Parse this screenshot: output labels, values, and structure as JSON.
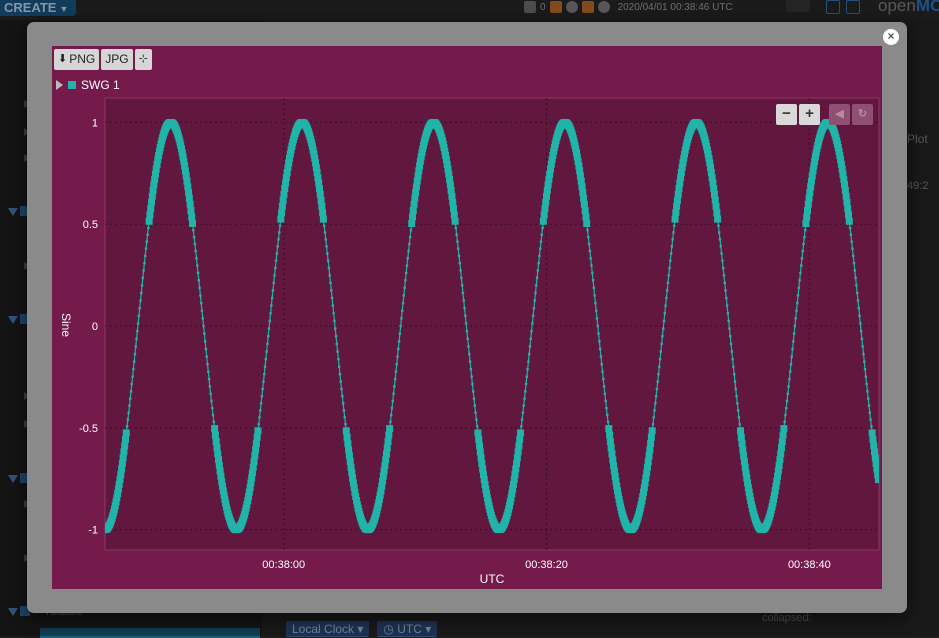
{
  "app": {
    "create_label": "CREATE",
    "status_time": "2020/04/01 00:38:46 UTC",
    "status_count": "0",
    "brand_prefix": "open",
    "brand_suffix": "MC",
    "left_bottom_label": "Tuttable",
    "right_peek_1": "Plot",
    "right_peek_2": "49:2",
    "right_peek_3": "collapsed:",
    "bottom_controls": {
      "local_clock": "Local Clock",
      "utc": "UTC"
    }
  },
  "modal": {
    "close_icon": "close-icon"
  },
  "toolbar": {
    "png_label": "PNG",
    "jpg_label": "JPG",
    "png_icon": "download-icon",
    "snap_icon": "crosshair-icon"
  },
  "legend": {
    "series_name": "SWG 1",
    "color": "#21b4a8"
  },
  "zoom": {
    "minus_label": "−",
    "plus_label": "+",
    "back_icon": "back-icon",
    "reset_icon": "reset-icon"
  },
  "colors": {
    "plot_panel": "#741b4b",
    "plot_area": "#62173f",
    "series": "#21b4a8",
    "modal": "#8a8a8a"
  },
  "chart_data": {
    "type": "line",
    "xlabel": "UTC",
    "ylabel": "Sine",
    "x_ticks": [
      "00:38:00",
      "00:38:20",
      "00:38:40"
    ],
    "x_tick_seconds": [
      0,
      20,
      40
    ],
    "xlim_seconds": [
      -13.6,
      45.3
    ],
    "y_ticks": [
      1,
      0.5,
      0,
      -0.5,
      -1
    ],
    "ylim": [
      -1.1,
      1.12
    ],
    "grid": true,
    "series": [
      {
        "name": "SWG 1",
        "wave": "sine",
        "amplitude": 1,
        "period_seconds": 10,
        "peak_times_seconds": [
          -8.6,
          1.4,
          11.4,
          21.4,
          31.4,
          41.4
        ]
      }
    ]
  }
}
